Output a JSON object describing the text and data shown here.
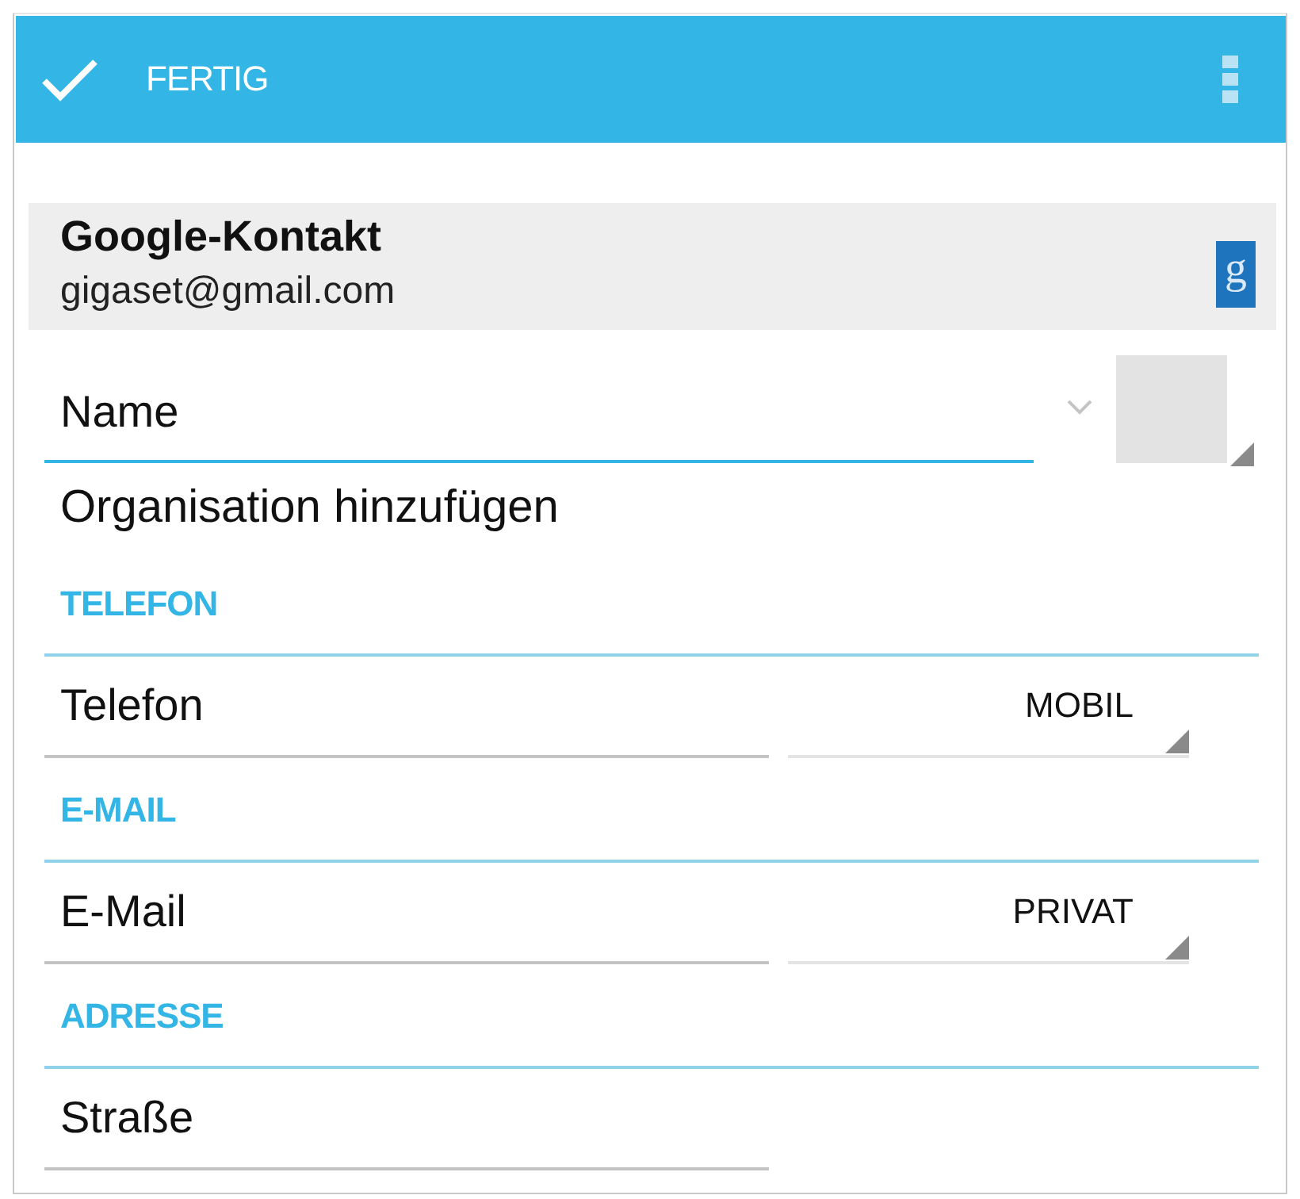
{
  "action_bar": {
    "done_label": "FERTIG"
  },
  "account": {
    "title": "Google-Kontakt",
    "email": "gigaset@gmail.com",
    "logo_letter": "g"
  },
  "name_field": {
    "placeholder": "Name",
    "focused": true
  },
  "organisation_link": "Organisation hinzufügen",
  "sections": [
    {
      "title": "TELEFON",
      "fields": [
        {
          "placeholder": "Telefon",
          "type": "MOBIL",
          "focused": false
        }
      ]
    },
    {
      "title": "E-MAIL",
      "fields": [
        {
          "placeholder": "E-Mail",
          "type": "PRIVAT",
          "focused": false
        }
      ]
    },
    {
      "title": "ADRESSE",
      "fields": [
        {
          "placeholder": "Straße",
          "focused": false
        }
      ]
    }
  ]
}
